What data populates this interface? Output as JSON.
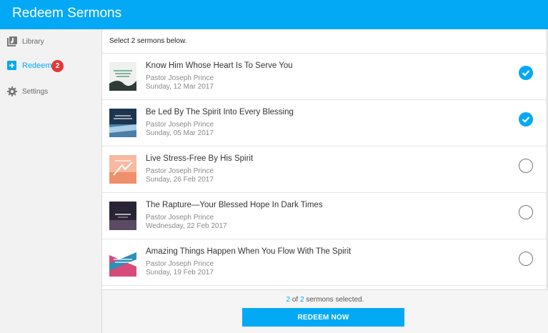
{
  "header": {
    "title": "Redeem Sermons"
  },
  "sidebar": {
    "items": [
      {
        "label": "Library",
        "icon": "library-icon"
      },
      {
        "label": "Redeem",
        "icon": "plus-box-icon",
        "badge": "2"
      },
      {
        "label": "Settings",
        "icon": "gear-icon"
      }
    ]
  },
  "main": {
    "instruction": "Select 2 sermons below.",
    "sermons": [
      {
        "title": "Know Him Whose Heart Is To Serve You",
        "pastor": "Pastor Joseph Prince",
        "date": "Sunday, 12 Mar 2017",
        "selected": true
      },
      {
        "title": "Be Led By The Spirit Into Every Blessing",
        "pastor": "Pastor Joseph Prince",
        "date": "Sunday, 05 Mar 2017",
        "selected": true
      },
      {
        "title": "Live Stress-Free By His Spirit",
        "pastor": "Pastor Joseph Prince",
        "date": "Sunday, 26 Feb 2017",
        "selected": false
      },
      {
        "title": "The Rapture—Your Blessed Hope In Dark Times",
        "pastor": "Pastor Joseph Prince",
        "date": "Wednesday, 22 Feb 2017",
        "selected": false
      },
      {
        "title": "Amazing Things Happen When You Flow With The Spirit",
        "pastor": "Pastor Joseph Prince",
        "date": "Sunday, 19 Feb 2017",
        "selected": false
      }
    ]
  },
  "footer": {
    "selected_count": "2",
    "of_text": "of",
    "total_count": "2",
    "suffix": "sermons selected.",
    "button_label": "REDEEM NOW"
  },
  "colors": {
    "accent": "#03a9f4",
    "badge": "#e53935"
  }
}
